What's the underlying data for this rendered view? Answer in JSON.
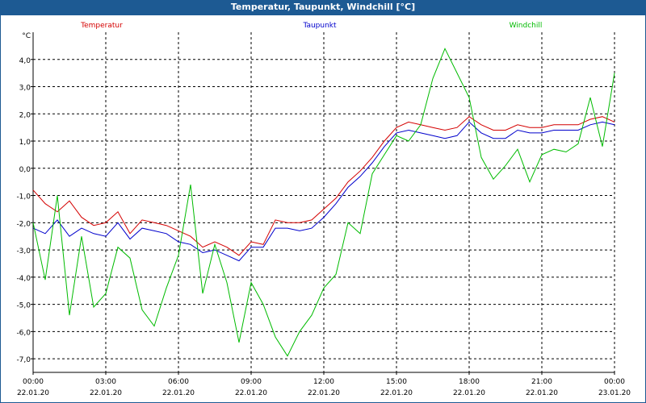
{
  "window": {
    "title": "Temperatur, Taupunkt, Windchill [°C]"
  },
  "colors": {
    "title_bar": "#1d5a93",
    "temperatur": "#d40000",
    "taupunkt": "#0000cc",
    "windchill": "#00bb00"
  },
  "chart_data": {
    "type": "line",
    "title": "Temperatur, Taupunkt, Windchill [°C]",
    "unit": "°C",
    "x_tick_times": [
      "00:00",
      "03:00",
      "06:00",
      "09:00",
      "12:00",
      "15:00",
      "18:00",
      "21:00",
      "00:00"
    ],
    "x_tick_dates": [
      "22.01.20",
      "22.01.20",
      "22.01.20",
      "22.01.20",
      "22.01.20",
      "22.01.20",
      "22.01.20",
      "22.01.20",
      "23.01.20"
    ],
    "y_ticks": [
      "4,0",
      "3,0",
      "2,0",
      "1,0",
      "0,0",
      "-1,0",
      "-2,0",
      "-3,0",
      "-4,0",
      "-5,0",
      "-6,0",
      "-7,0"
    ],
    "ylim": [
      -7.5,
      5.0
    ],
    "xlim": [
      "22.01.20 00:00",
      "23.01.20 00:00"
    ],
    "grid": true,
    "legend_position": "top",
    "series": [
      {
        "name": "Temperatur",
        "color": "#d40000",
        "x": [
          "00:00",
          "00:30",
          "01:00",
          "01:30",
          "02:00",
          "02:30",
          "03:00",
          "03:30",
          "04:00",
          "04:30",
          "05:00",
          "05:30",
          "06:00",
          "06:30",
          "07:00",
          "07:30",
          "08:00",
          "08:30",
          "09:00",
          "09:30",
          "10:00",
          "10:30",
          "11:00",
          "11:30",
          "12:00",
          "12:30",
          "13:00",
          "13:30",
          "14:00",
          "14:30",
          "15:00",
          "15:30",
          "16:00",
          "16:30",
          "17:00",
          "17:30",
          "18:00",
          "18:30",
          "19:00",
          "19:30",
          "20:00",
          "20:30",
          "21:00",
          "21:30",
          "22:00",
          "22:30",
          "23:00",
          "23:30",
          "00:00"
        ],
        "y": [
          -0.8,
          -1.3,
          -1.6,
          -1.2,
          -1.8,
          -2.1,
          -2.0,
          -1.6,
          -2.4,
          -1.9,
          -2.0,
          -2.1,
          -2.3,
          -2.5,
          -2.9,
          -2.7,
          -2.9,
          -3.2,
          -2.7,
          -2.8,
          -1.9,
          -2.0,
          -2.0,
          -1.9,
          -1.5,
          -1.1,
          -0.5,
          -0.1,
          0.4,
          1.0,
          1.5,
          1.7,
          1.6,
          1.5,
          1.4,
          1.5,
          1.9,
          1.6,
          1.4,
          1.4,
          1.6,
          1.5,
          1.5,
          1.6,
          1.6,
          1.6,
          1.8,
          1.9,
          1.7
        ]
      },
      {
        "name": "Taupunkt",
        "color": "#0000cc",
        "x": [
          "00:00",
          "00:30",
          "01:00",
          "01:30",
          "02:00",
          "02:30",
          "03:00",
          "03:30",
          "04:00",
          "04:30",
          "05:00",
          "05:30",
          "06:00",
          "06:30",
          "07:00",
          "07:30",
          "08:00",
          "08:30",
          "09:00",
          "09:30",
          "10:00",
          "10:30",
          "11:00",
          "11:30",
          "12:00",
          "12:30",
          "13:00",
          "13:30",
          "14:00",
          "14:30",
          "15:00",
          "15:30",
          "16:00",
          "16:30",
          "17:00",
          "17:30",
          "18:00",
          "18:30",
          "19:00",
          "19:30",
          "20:00",
          "20:30",
          "21:00",
          "21:30",
          "22:00",
          "22:30",
          "23:00",
          "23:30",
          "00:00"
        ],
        "y": [
          -2.2,
          -2.4,
          -1.9,
          -2.5,
          -2.2,
          -2.4,
          -2.5,
          -2.0,
          -2.6,
          -2.2,
          -2.3,
          -2.4,
          -2.7,
          -2.8,
          -3.1,
          -3.0,
          -3.2,
          -3.4,
          -2.9,
          -2.9,
          -2.2,
          -2.2,
          -2.3,
          -2.2,
          -1.8,
          -1.3,
          -0.7,
          -0.3,
          0.2,
          0.8,
          1.3,
          1.4,
          1.3,
          1.2,
          1.1,
          1.2,
          1.7,
          1.3,
          1.1,
          1.1,
          1.4,
          1.3,
          1.3,
          1.4,
          1.4,
          1.4,
          1.6,
          1.7,
          1.6
        ]
      },
      {
        "name": "Windchill",
        "color": "#00bb00",
        "x": [
          "00:00",
          "00:30",
          "01:00",
          "01:30",
          "02:00",
          "02:30",
          "03:00",
          "03:30",
          "04:00",
          "04:30",
          "05:00",
          "05:30",
          "06:00",
          "06:30",
          "07:00",
          "07:30",
          "08:00",
          "08:30",
          "09:00",
          "09:30",
          "10:00",
          "10:30",
          "11:00",
          "11:30",
          "12:00",
          "12:30",
          "13:00",
          "13:30",
          "14:00",
          "14:30",
          "15:00",
          "15:30",
          "16:00",
          "16:30",
          "17:00",
          "17:30",
          "18:00",
          "18:30",
          "19:00",
          "19:30",
          "20:00",
          "20:30",
          "21:00",
          "21:30",
          "22:00",
          "22:30",
          "23:00",
          "23:30",
          "00:00"
        ],
        "y": [
          -2.0,
          -4.1,
          -1.0,
          -5.4,
          -2.5,
          -5.1,
          -4.6,
          -2.9,
          -3.3,
          -5.2,
          -5.8,
          -4.4,
          -3.2,
          -0.6,
          -4.6,
          -2.8,
          -4.2,
          -6.4,
          -4.2,
          -5.0,
          -6.2,
          -6.9,
          -6.0,
          -5.4,
          -4.4,
          -3.9,
          -2.0,
          -2.4,
          -0.2,
          0.5,
          1.2,
          1.0,
          1.6,
          3.3,
          4.4,
          3.5,
          2.6,
          0.4,
          -0.4,
          0.1,
          0.7,
          -0.5,
          0.5,
          0.7,
          0.6,
          0.9,
          2.6,
          0.8,
          3.5
        ]
      }
    ]
  }
}
